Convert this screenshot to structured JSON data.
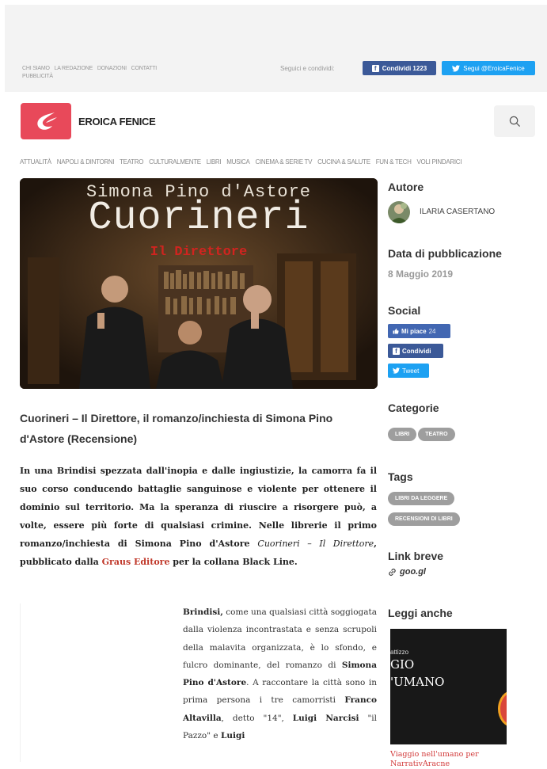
{
  "topbar": {
    "links": [
      "CHI SIAMO",
      "LA REDAZIONE",
      "DONAZIONI",
      "CONTATTI",
      "PUBBLICITÀ"
    ],
    "follow_label": "Seguici e condividi:",
    "share_label": "Condividi 1223",
    "follow_twitter_label": "Segui @EroicaFenice"
  },
  "brand": {
    "name": "EROICA FENICE",
    "color": "#e8495a"
  },
  "nav": {
    "items": [
      "ATTUALITÀ",
      "NAPOLI & DINTORNI",
      "TEATRO",
      "CULTURALMENTE",
      "LIBRI",
      "MUSICA",
      "CINEMA & SERIE TV",
      "CUCINA & SALUTE",
      "FUN & TECH",
      "VOLI PINDARICI"
    ]
  },
  "hero": {
    "author": "Simona Pino d'Astore",
    "title": "Cuorineri",
    "subtitle": "Il Direttore"
  },
  "article": {
    "title": "Cuorineri – Il Direttore, il romanzo/inchiesta di Simona Pino d'Astore (Recensione)",
    "lead_part1": "In una Brindisi spezzata dall'inopia e dalle ingiustizie, la camorra fa il suo corso conducendo battaglie sanguinose e violente per ottenere il dominio sul territorio. Ma la speranza di riuscire a risorgere può, a volte, essere più forte di qualsiasi crimine. Nelle librerie il primo romanzo/inchiesta di Simona Pino d'Astore ",
    "lead_book": "Cuorineri – Il Direttore",
    "lead_part2": ", pubblicato dalla ",
    "lead_link": "Graus Editore",
    "lead_part3": " per la collana Black Line.",
    "body_b1": "Brindisi,",
    "body_t1": " come una qualsiasi città soggiogata dalla violenza incontrastata e senza scrupoli della malavita organizzata, è lo sfondo, e fulcro dominante, del romanzo di ",
    "body_b2": "Simona Pino d'Astore",
    "body_t2": ". A raccontare la città sono in prima persona i tre camorristi ",
    "body_b3": "Franco Altavilla",
    "body_t3": ", detto \"14\", ",
    "body_b4": "Luigi Narcisi",
    "body_t4": " \"il Pazzo\" e ",
    "body_b5": "Luigi"
  },
  "sidebar": {
    "author_heading": "Autore",
    "author_name": "ILARIA CASERTANO",
    "date_heading": "Data di pubblicazione",
    "date_value": "8 Maggio 2019",
    "social_heading": "Social",
    "like_label": "Mi piace",
    "like_count": "24",
    "share_label": "Condividi",
    "tweet_label": "Tweet",
    "categories_heading": "Categorie",
    "categories": [
      "LIBRI",
      "TEATRO"
    ],
    "tags_heading": "Tags",
    "tags": [
      "LIBRI DA LEGGERE",
      "RECENSIONI DI LIBRI"
    ],
    "shortlink_heading": "Link breve",
    "shortlink_value": "goo.gl",
    "readmore_heading": "Leggi anche",
    "readmore_img_line1": "attizzo",
    "readmore_img_line2": "GIO",
    "readmore_img_line3": "'UMANO",
    "readmore_caption": "Viaggio nell'umano per NarrativAracne"
  },
  "colors": {
    "facebook": "#3b5998",
    "facebook_like": "#4267b2",
    "twitter": "#1da1f2",
    "link": "#c0392b",
    "pill": "#9e9e9e"
  },
  "icons": [
    "facebook-icon",
    "twitter-icon",
    "search-icon",
    "like-icon",
    "link-icon",
    "phoenix-logo-icon"
  ]
}
